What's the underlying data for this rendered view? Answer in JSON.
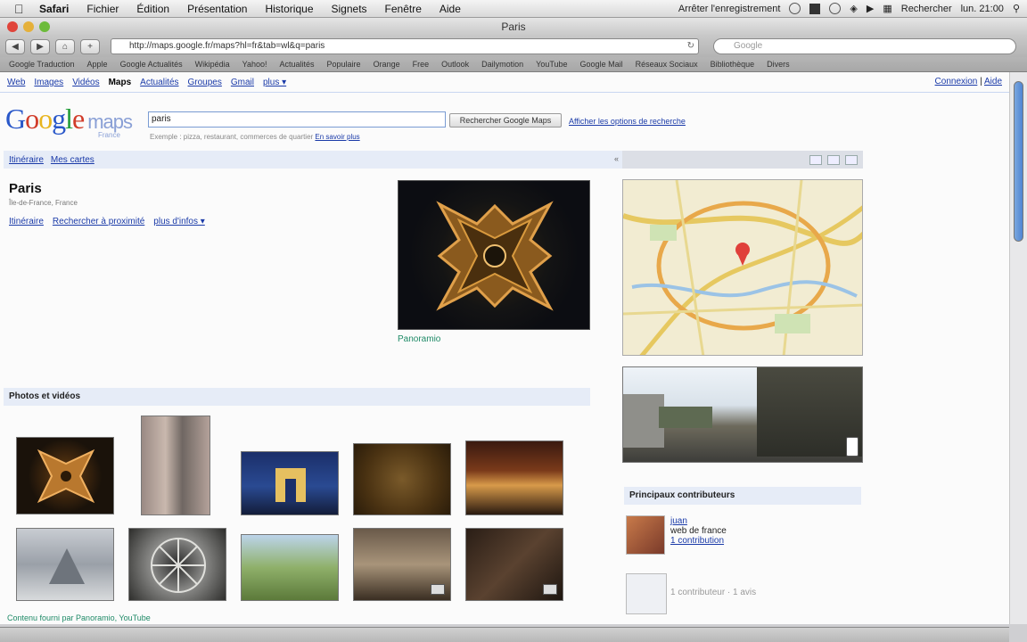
{
  "menubar": {
    "apple": "",
    "items": [
      "Safari",
      "Fichier",
      "Édition",
      "Présentation",
      "Historique",
      "Signets",
      "Fenêtre",
      "Aide"
    ],
    "right": {
      "recording": "Arrêter l'enregistrement",
      "search_label": "Rechercher",
      "time": "lun. 21:00"
    }
  },
  "window": {
    "title": "Paris",
    "url": "http://maps.google.fr/maps?hl=fr&tab=wl&q=paris",
    "search_placeholder": "Google",
    "bookmarks": [
      "Google Traduction",
      "Apple",
      "Google Actualités",
      "Wikipédia",
      "Yahoo!",
      "Actualités",
      "Populaire",
      "Orange",
      "Free",
      "Outlook",
      "Dailymotion",
      "YouTube",
      "Google Mail",
      "Réseaux Sociaux",
      "Bibliothèque",
      "Divers"
    ]
  },
  "gbar": {
    "links": [
      "Web",
      "Images",
      "Vidéos",
      "Maps",
      "Actualités",
      "Groupes",
      "Gmail",
      "plus ▾"
    ],
    "current": "Maps",
    "signin": "Connexion",
    "help": "Aide",
    "sep": "|"
  },
  "logo": {
    "G": "G",
    "o1": "o",
    "o2": "o",
    "g": "g",
    "l": "l",
    "e": "e",
    "maps": "maps",
    "sub": "France"
  },
  "search": {
    "value": "paris",
    "button": "Rechercher Google Maps",
    "options": "Afficher les options de recherche",
    "hint": "Exemple : pizza, restaurant, commerces de quartier",
    "hint_link": "En savoir plus"
  },
  "leftbar": {
    "links": [
      "Itinéraire",
      "Mes cartes"
    ],
    "collapse": "«"
  },
  "place": {
    "title": "Paris",
    "sub": "Île-de-France, France",
    "links": [
      "Itinéraire",
      "Rechercher à proximité",
      "plus d'infos ▾"
    ]
  },
  "main_photo": {
    "credit": "Panoramio"
  },
  "photos_section": {
    "title": "Photos et vidéos",
    "source": "Contenu fourni par Panoramio, YouTube"
  },
  "contributors": {
    "title": "Principaux contributeurs",
    "items": [
      {
        "name": "juan",
        "desc": "web de france",
        "count": "1 contribution"
      },
      {
        "name": "",
        "desc": "",
        "count": "1 contributeur · 1 avis"
      }
    ]
  },
  "statusbar": {
    "text": ""
  },
  "colors": {
    "link": "#1a3aa8",
    "bar": "#e6ecf7",
    "green": "#1f8a67",
    "blue": "#2a58c9",
    "red": "#d13c2a",
    "yellow": "#e8b51f"
  }
}
